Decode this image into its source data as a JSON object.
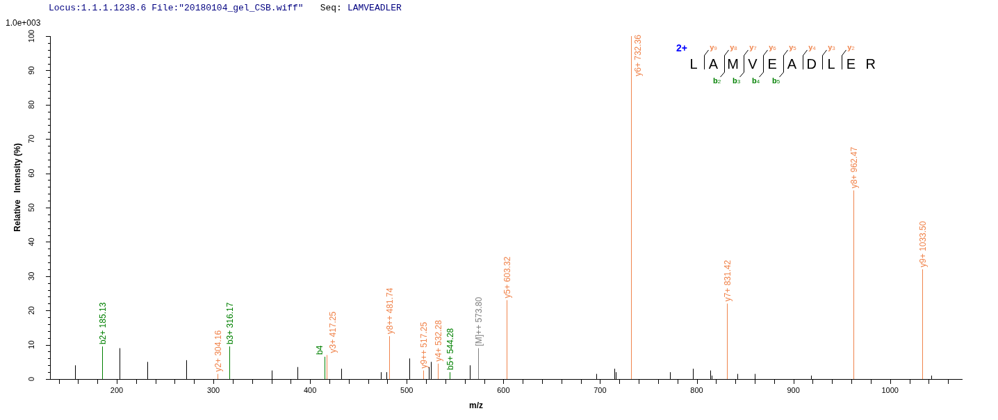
{
  "header": {
    "locus_file": "Locus:1.1.1.1238.6 File:\"20180104_gel_CSB.wiff\"",
    "seq_label": "Seq:",
    "sequence": "LAMVEADLER"
  },
  "spectrum": {
    "scale_label": "1.0e+003",
    "peptide": {
      "charge": "2+",
      "residues": [
        "L",
        "A",
        "M",
        "V",
        "E",
        "A",
        "D",
        "L",
        "E",
        "R"
      ],
      "gaps": [
        {
          "y": "y9"
        },
        {
          "y": "y8",
          "b": "b2"
        },
        {
          "y": "y7",
          "b": "b3"
        },
        {
          "y": "y6",
          "b": "b4"
        },
        {
          "y": "y5",
          "b": "b5"
        },
        {
          "y": "y4"
        },
        {
          "y": "y3"
        },
        {
          "y": "y2"
        }
      ]
    },
    "chart_data": {
      "type": "bar",
      "xlabel": "m/z",
      "ylabel": "Relative   Intensity (%)",
      "xlim": [
        131,
        1075
      ],
      "ylim": [
        0,
        100
      ],
      "xticks": [
        200,
        300,
        400,
        500,
        600,
        700,
        800,
        900,
        1000
      ],
      "yticks": [
        0,
        10,
        20,
        30,
        40,
        50,
        60,
        70,
        80,
        90,
        100
      ],
      "x": [
        157,
        185.13,
        203,
        232,
        272,
        304.16,
        316.17,
        360,
        387,
        415.2,
        417.25,
        432,
        473,
        479,
        481.74,
        503,
        517.25,
        522.5,
        525,
        532.28,
        544.28,
        565,
        573.8,
        603.32,
        696,
        715,
        716,
        732.36,
        772,
        796,
        814,
        815.5,
        831.42,
        842,
        860,
        918,
        962.47,
        1033.5,
        1043
      ],
      "series": [
        {
          "color": "#008000",
          "values": [
            null,
            9.5,
            null,
            null,
            null,
            null,
            9.5,
            null,
            null,
            6.5,
            null,
            null,
            null,
            null,
            null,
            null,
            null,
            null,
            null,
            null,
            2,
            null,
            null,
            null,
            null,
            null,
            null,
            null,
            null,
            null,
            null,
            null,
            null,
            null,
            null,
            null,
            null,
            null,
            null
          ]
        },
        {
          "color": "#f0844c",
          "values": [
            null,
            null,
            null,
            null,
            null,
            1.5,
            null,
            null,
            null,
            null,
            7,
            null,
            null,
            null,
            12.5,
            null,
            2.5,
            null,
            null,
            4.5,
            null,
            null,
            null,
            23,
            null,
            null,
            null,
            100,
            null,
            null,
            null,
            null,
            22,
            null,
            null,
            null,
            55,
            32,
            null
          ]
        },
        {
          "color": "#808080",
          "values": [
            null,
            null,
            null,
            null,
            null,
            null,
            null,
            null,
            null,
            null,
            null,
            null,
            null,
            null,
            null,
            null,
            null,
            null,
            null,
            null,
            null,
            null,
            9,
            null,
            null,
            null,
            null,
            null,
            null,
            null,
            null,
            null,
            null,
            null,
            null,
            null,
            null,
            null,
            null
          ]
        },
        {
          "color": "#000000",
          "values": [
            4,
            null,
            9,
            5,
            5.5,
            null,
            null,
            2.5,
            3.5,
            null,
            null,
            3,
            2,
            2,
            null,
            6,
            null,
            3.5,
            5,
            null,
            null,
            4,
            null,
            null,
            1.5,
            3,
            2,
            null,
            2,
            3,
            2.5,
            1,
            null,
            1.5,
            1.5,
            1,
            null,
            null,
            1
          ]
        }
      ],
      "value_labels": [
        null,
        "b2+ 185.13",
        null,
        null,
        null,
        "y2+ 304.16",
        "b3+ 316.17",
        null,
        null,
        "b4",
        "y3+ 417.25",
        null,
        null,
        null,
        "y8++ 481.74",
        null,
        "y9++ 517.25",
        null,
        null,
        "y4+ 532.28",
        "b5+ 544.28",
        null,
        "[M]++ 573.80",
        "y5+ 603.32",
        null,
        null,
        null,
        "y6+ 732.36",
        null,
        null,
        null,
        null,
        "y7+ 831.42",
        null,
        null,
        null,
        "y8+ 962.47",
        "y9+ 1033.50",
        null
      ]
    }
  }
}
